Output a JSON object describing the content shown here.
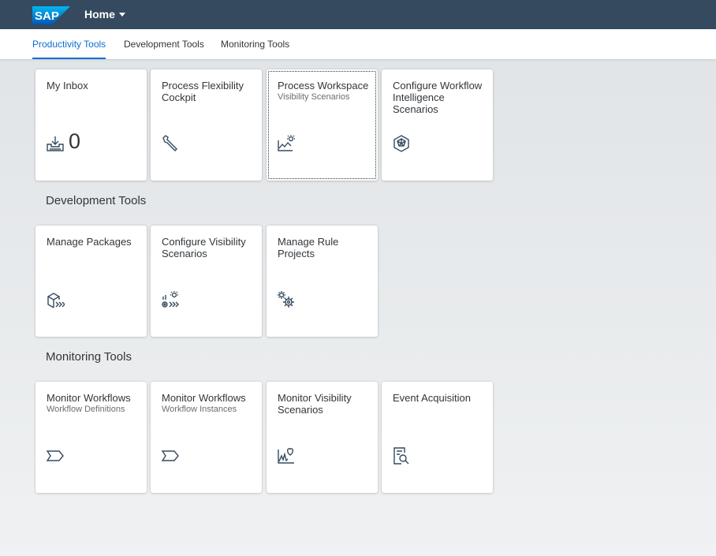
{
  "shell": {
    "logo_text": "SAP",
    "home_label": "Home",
    "bar_color": "#354a5f"
  },
  "tabs": [
    {
      "label": "Productivity Tools",
      "active": true
    },
    {
      "label": "Development Tools",
      "active": false
    },
    {
      "label": "Monitoring Tools",
      "active": false
    }
  ],
  "groups": {
    "productivity": {
      "tiles": [
        {
          "title": "My Inbox",
          "subtitle": "",
          "icon": "inbox-download-icon",
          "count": "0"
        },
        {
          "title": "Process Flexibility Cockpit",
          "subtitle": "",
          "icon": "wrench-icon"
        },
        {
          "title": "Process Workspace",
          "subtitle": "Visibility Scenarios",
          "icon": "line-chart-sun-icon"
        },
        {
          "title": "Configure Workflow Intelligence Scenarios",
          "subtitle": "",
          "icon": "cube-network-icon"
        }
      ]
    },
    "development": {
      "title": "Development Tools",
      "tiles": [
        {
          "title": "Manage Packages",
          "subtitle": "",
          "icon": "package-forward-icon"
        },
        {
          "title": "Configure Visibility Scenarios",
          "subtitle": "",
          "icon": "settings-sun-forward-icon"
        },
        {
          "title": "Manage Rule Projects",
          "subtitle": "",
          "icon": "gears-icon"
        }
      ]
    },
    "monitoring": {
      "title": "Monitoring Tools",
      "tiles": [
        {
          "title": "Monitor Workflows",
          "subtitle": "Workflow Definitions",
          "icon": "process-arrow-icon"
        },
        {
          "title": "Monitor Workflows",
          "subtitle": "Workflow Instances",
          "icon": "process-arrow-icon"
        },
        {
          "title": "Monitor Visibility Scenarios",
          "subtitle": "",
          "icon": "heart-pulse-icon"
        },
        {
          "title": "Event Acquisition",
          "subtitle": "",
          "icon": "document-search-icon"
        }
      ]
    }
  },
  "colors": {
    "accent": "#0a6ed1",
    "icon": "#354a5f"
  }
}
